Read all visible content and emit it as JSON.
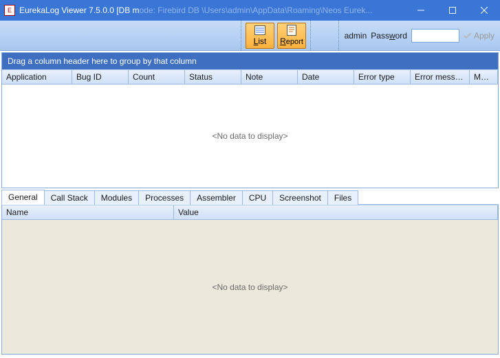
{
  "window": {
    "title_prefix": "EurekaLog Viewer 7.5.0.0 [DB m",
    "title_faded": "ode: Firebird DB     \\Users\\admin\\AppData\\Roaming\\Neos Eurek..."
  },
  "toolbar": {
    "list_label": "List",
    "report_label": "Report",
    "admin_label": "admin",
    "password_label": "Password",
    "password_value": "",
    "apply_label": "Apply"
  },
  "upper_grid": {
    "group_hint": "Drag a column header here to group by that column",
    "columns": [
      "Application",
      "Bug ID",
      "Count",
      "Status",
      "Note",
      "Date",
      "Error type",
      "Error message",
      "Module Na..."
    ],
    "empty_text": "<No data to display>"
  },
  "tablist": [
    "General",
    "Call Stack",
    "Modules",
    "Processes",
    "Assembler",
    "CPU",
    "Screenshot",
    "Files"
  ],
  "lower_grid": {
    "columns": [
      "Name",
      "Value"
    ],
    "empty_text": "<No data to display>"
  }
}
